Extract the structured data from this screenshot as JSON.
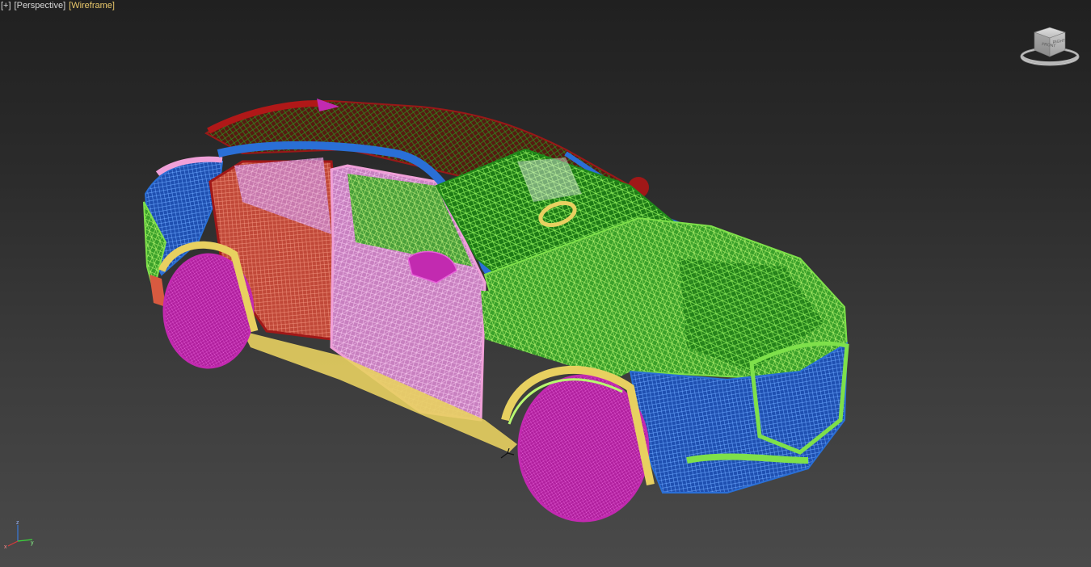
{
  "viewport": {
    "label_plus": "[+]",
    "label_view": "[Perspective]",
    "label_shading": "[Wireframe]",
    "active_color": "#e8c76a",
    "text_color": "#d8d8d8"
  },
  "viewcube": {
    "icon": "viewcube-icon",
    "faces": [
      "TOP",
      "FRONT",
      "RIGHT"
    ]
  },
  "axis": {
    "icon": "axis-tripod-icon",
    "x": "x",
    "y": "y",
    "z": "z"
  },
  "scene": {
    "object": "car-wireframe-model",
    "colors": {
      "body_green": "#7ee04a",
      "dark_green": "#1f8a1a",
      "blue": "#2a6fd6",
      "magenta": "#c22ab0",
      "pink": "#f0a0d8",
      "red": "#a01818",
      "salmon": "#e06a5a",
      "yellow": "#e8d060"
    }
  }
}
